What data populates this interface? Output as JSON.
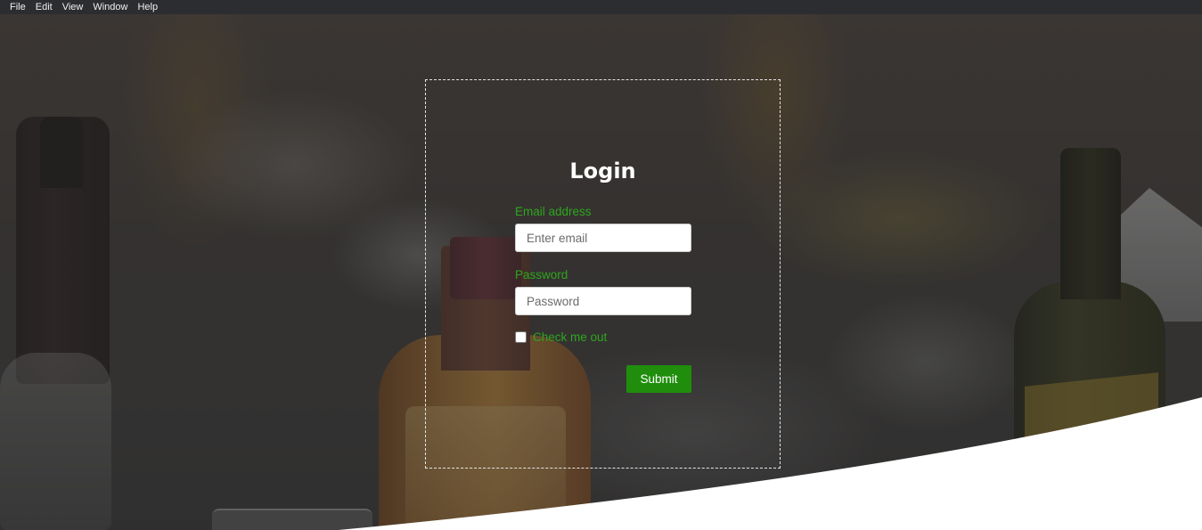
{
  "menubar": {
    "items": [
      "File",
      "Edit",
      "View",
      "Window",
      "Help"
    ]
  },
  "login": {
    "title": "Login",
    "email_label": "Email address",
    "email_placeholder": "Enter email",
    "password_label": "Password",
    "password_placeholder": "Password",
    "checkbox_label": "Check me out",
    "checkbox_checked": false,
    "submit_label": "Submit"
  },
  "colors": {
    "label_green": "#2ea61e",
    "button_green": "#208e0c",
    "menubar_bg": "#2b2d31"
  }
}
